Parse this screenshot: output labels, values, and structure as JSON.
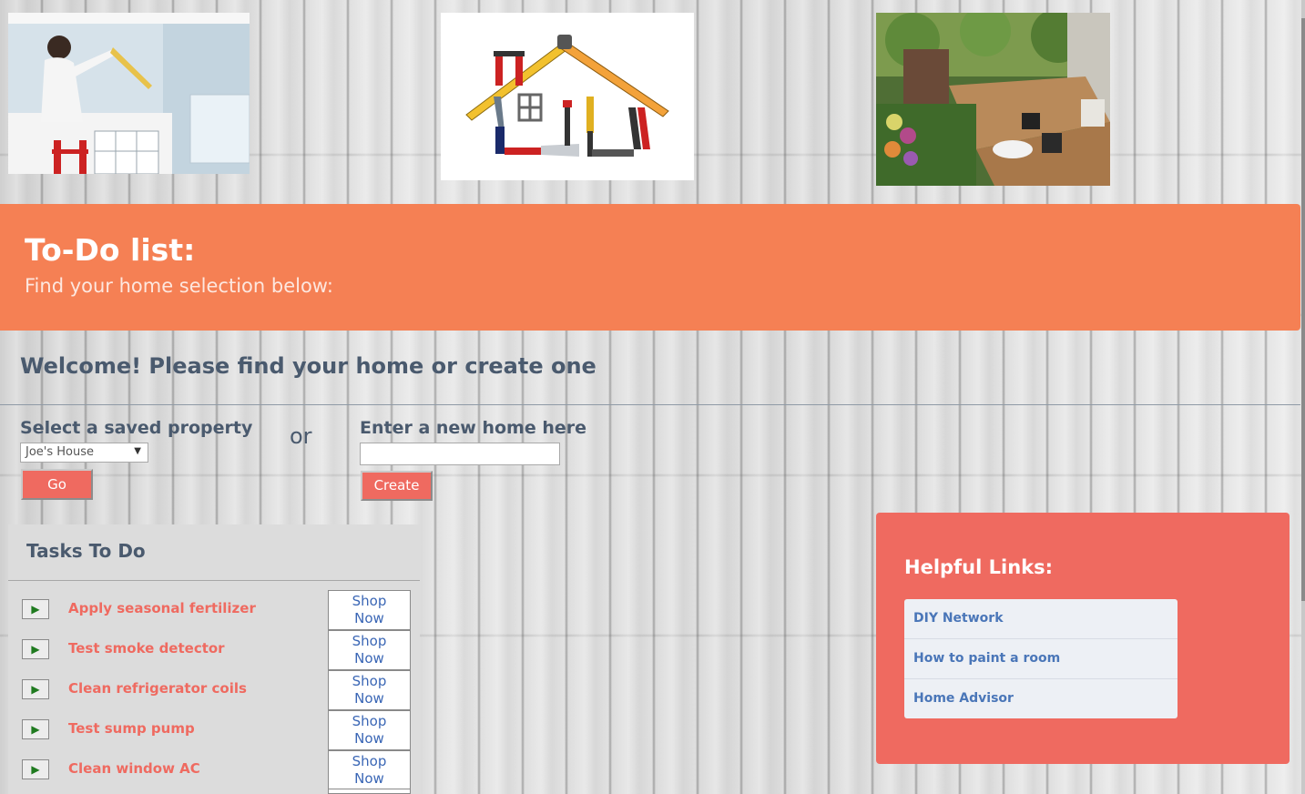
{
  "header": {
    "images": [
      {
        "name": "painter-photo"
      },
      {
        "name": "tools-house-logo"
      },
      {
        "name": "deck-photo"
      }
    ]
  },
  "banner": {
    "title": "To-Do list:",
    "subtitle": "Find your home selection below:"
  },
  "welcome": "Welcome! Please find your home or create one",
  "property_form": {
    "saved_label": "Select a saved property",
    "selected_property": "Joe's House",
    "go_label": "Go",
    "or_label": "or",
    "new_label": "Enter a new home here",
    "new_value": "",
    "create_label": "Create"
  },
  "tasks": {
    "title": "Tasks To Do",
    "shop_label_1": "Shop",
    "shop_label_2": "Now",
    "items": [
      {
        "label": "Apply seasonal fertilizer"
      },
      {
        "label": "Test smoke detector"
      },
      {
        "label": "Clean refrigerator coils"
      },
      {
        "label": "Test sump pump"
      },
      {
        "label": "Clean window AC"
      }
    ]
  },
  "helpful_links": {
    "title": "Helpful Links:",
    "items": [
      {
        "label": "DIY Network"
      },
      {
        "label": "How to paint a room"
      },
      {
        "label": "Home Advisor"
      }
    ]
  },
  "colors": {
    "banner": "#f58054",
    "accent_red": "#ef6a60",
    "heading_text": "#4a5a6e",
    "link_text": "#4a76b8"
  }
}
